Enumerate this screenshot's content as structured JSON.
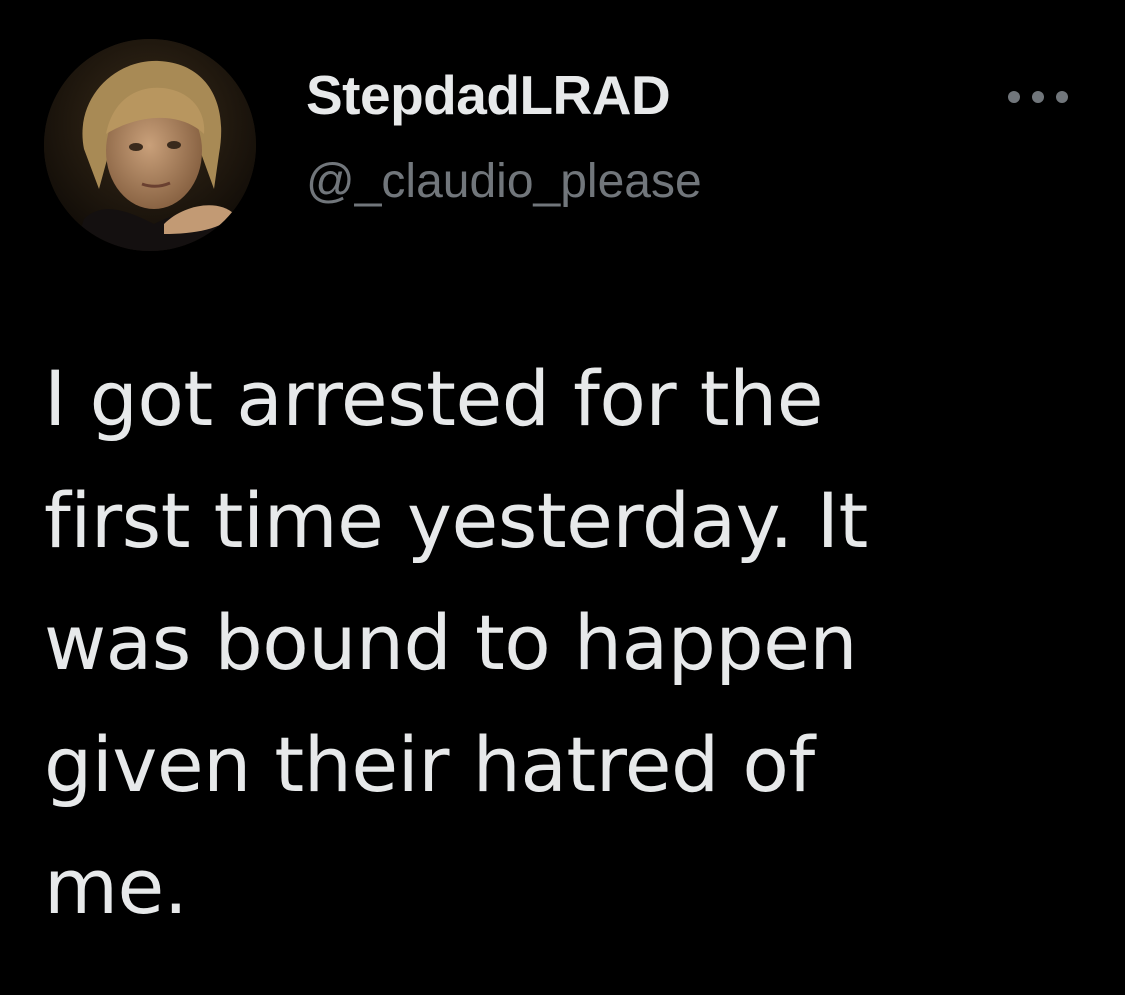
{
  "tweet": {
    "author": {
      "display_name": "StepdadLRAD",
      "handle": "@_claudio_please",
      "avatar_icon": "user-avatar-photo"
    },
    "more_icon": "more-options-icon",
    "text_lines": [
      "I got arrested for the",
      "first time yesterday. It",
      "was bound to happen",
      "given their hatred of",
      "me."
    ]
  },
  "colors": {
    "background": "#000000",
    "primary_text": "#e7e9ea",
    "secondary_text": "#71767b"
  }
}
